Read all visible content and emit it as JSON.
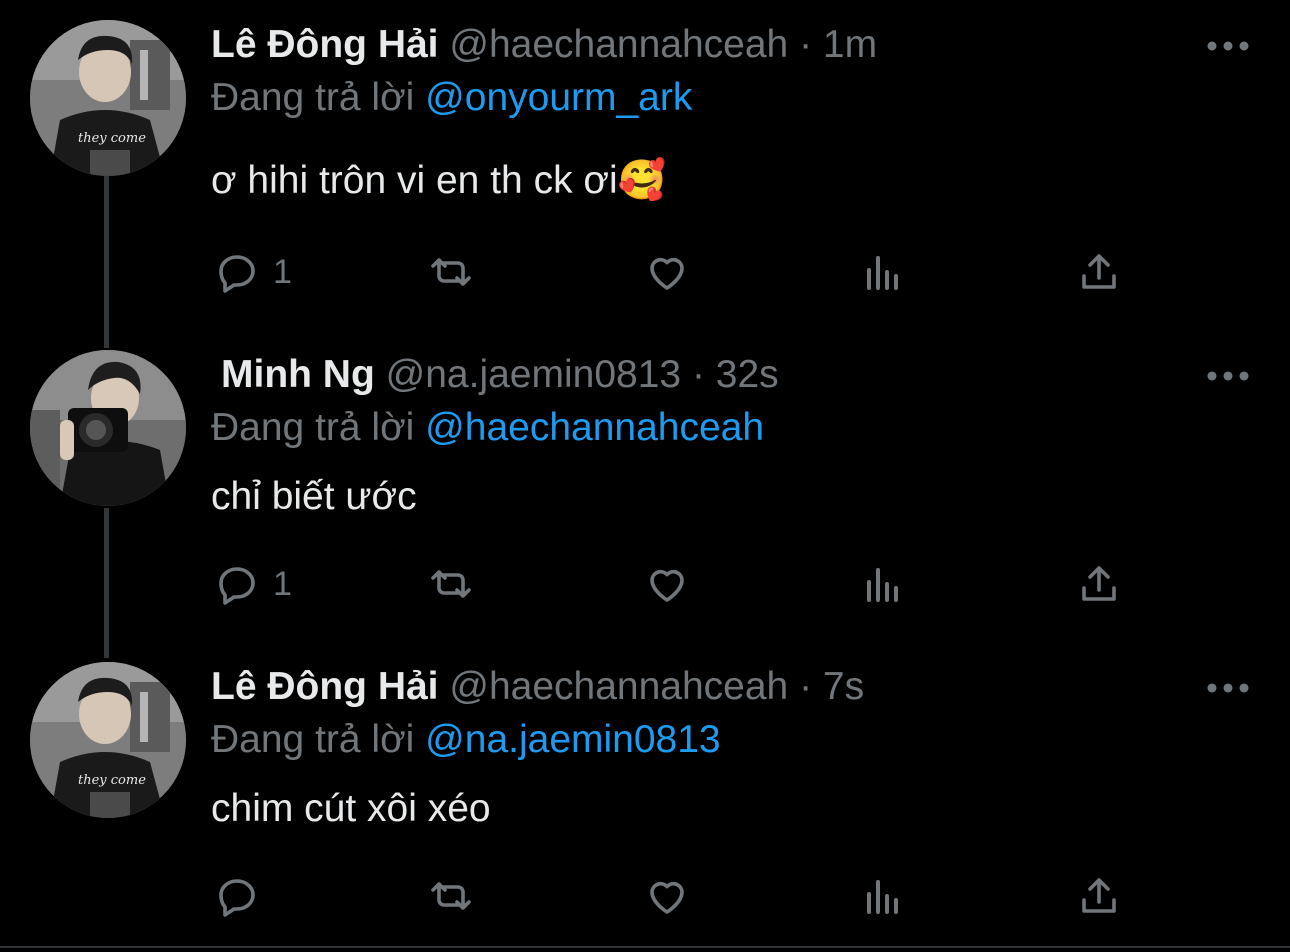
{
  "colors": {
    "background": "#000000",
    "text": "#e7e9ea",
    "muted": "#71767b",
    "link": "#1d9bf0",
    "thread_line": "#333639"
  },
  "reply_prefix": "Đang trả lời",
  "tweets": [
    {
      "display_name": "Lê Đông Hải",
      "handle": "@haechannahceah",
      "separator": "·",
      "time": "1m",
      "reply_to": "@onyourm_ark",
      "text": "ơ hihi trôn vi en th ck ơi",
      "emoji": "🥰",
      "avatar": "avatar-man-black-tee",
      "reply_count": "1"
    },
    {
      "display_name": "Minh Ng",
      "handle": "@na.jaemin0813",
      "separator": "·",
      "time": "32s",
      "reply_to": "@haechannahceah",
      "text": "chỉ biết ước",
      "avatar": "avatar-man-camera",
      "reply_count": "1"
    },
    {
      "display_name": "Lê Đông Hải",
      "handle": "@haechannahceah",
      "separator": "·",
      "time": "7s",
      "reply_to": "@na.jaemin0813",
      "text": "chim cút xôi xéo",
      "avatar": "avatar-man-black-tee",
      "reply_count": ""
    }
  ]
}
